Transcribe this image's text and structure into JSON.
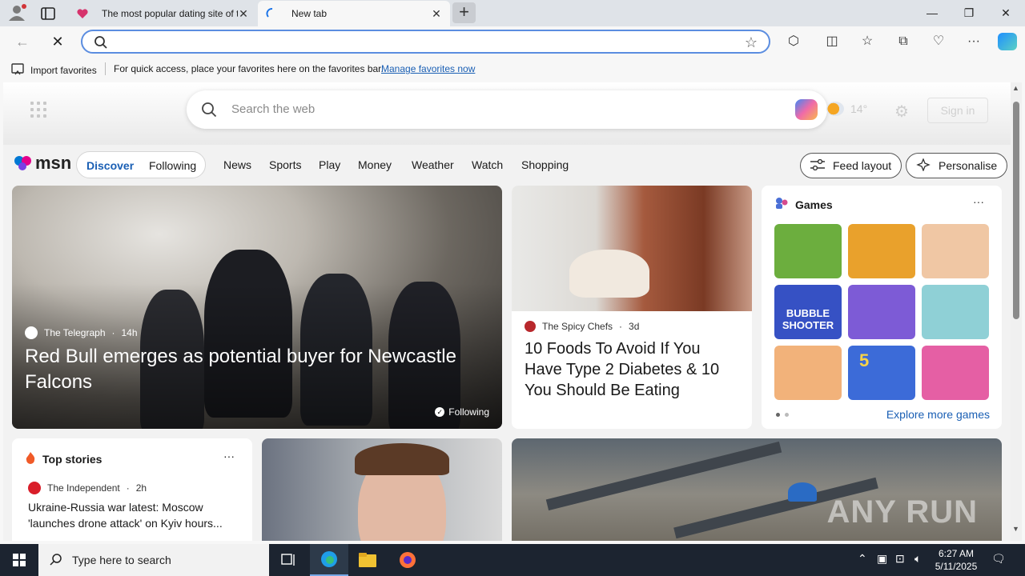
{
  "browser": {
    "tabs": [
      {
        "title": "The most popular dating site of the",
        "active": false
      },
      {
        "title": "New tab",
        "active": true
      }
    ],
    "address_value": "",
    "favorites_bar": {
      "import_label": "Import favorites",
      "message": "For quick access, place your favorites here on the favorites bar.",
      "manage_link": "Manage favorites now"
    }
  },
  "msn": {
    "search_placeholder": "Search the web",
    "weather_temp": "14°",
    "sign_in": "Sign in",
    "logo_text": "msn",
    "pill_tabs": [
      "Discover",
      "Following"
    ],
    "nav_links": [
      "News",
      "Sports",
      "Play",
      "Money",
      "Weather",
      "Watch",
      "Shopping"
    ],
    "feed_layout": "Feed layout",
    "personalise": "Personalise",
    "hero": {
      "source": "The Telegraph",
      "age": "14h",
      "headline": "Red Bull emerges as potential buyer for Newcastle Falcons",
      "following": "Following"
    },
    "food": {
      "source": "The Spicy Chefs",
      "age": "3d",
      "headline": "10 Foods To Avoid If You Have Type 2 Diabetes & 10 You Should Be Eating"
    },
    "games": {
      "title": "Games",
      "more": "···",
      "explore": "Explore more games",
      "tile_colors": [
        "#6cae3e",
        "#e9a12c",
        "#f0c7a4",
        "#3651c4",
        "#7d5bd6",
        "#8fd0d6",
        "#f2b27a",
        "#3c6bd8",
        "#e55fa4"
      ],
      "tile_text": {
        "bubble": "BUBBLE SHOOTER",
        "five": "5"
      }
    },
    "top_stories": {
      "title": "Top stories",
      "more": "···",
      "source": "The Independent",
      "age": "2h",
      "headline": "Ukraine-Russia war latest: Moscow 'launches drone attack' on Kyiv hours..."
    },
    "watermark": "ANY RUN"
  },
  "taskbar": {
    "search_placeholder": "Type here to search",
    "time": "6:27 AM",
    "date": "5/11/2025"
  }
}
